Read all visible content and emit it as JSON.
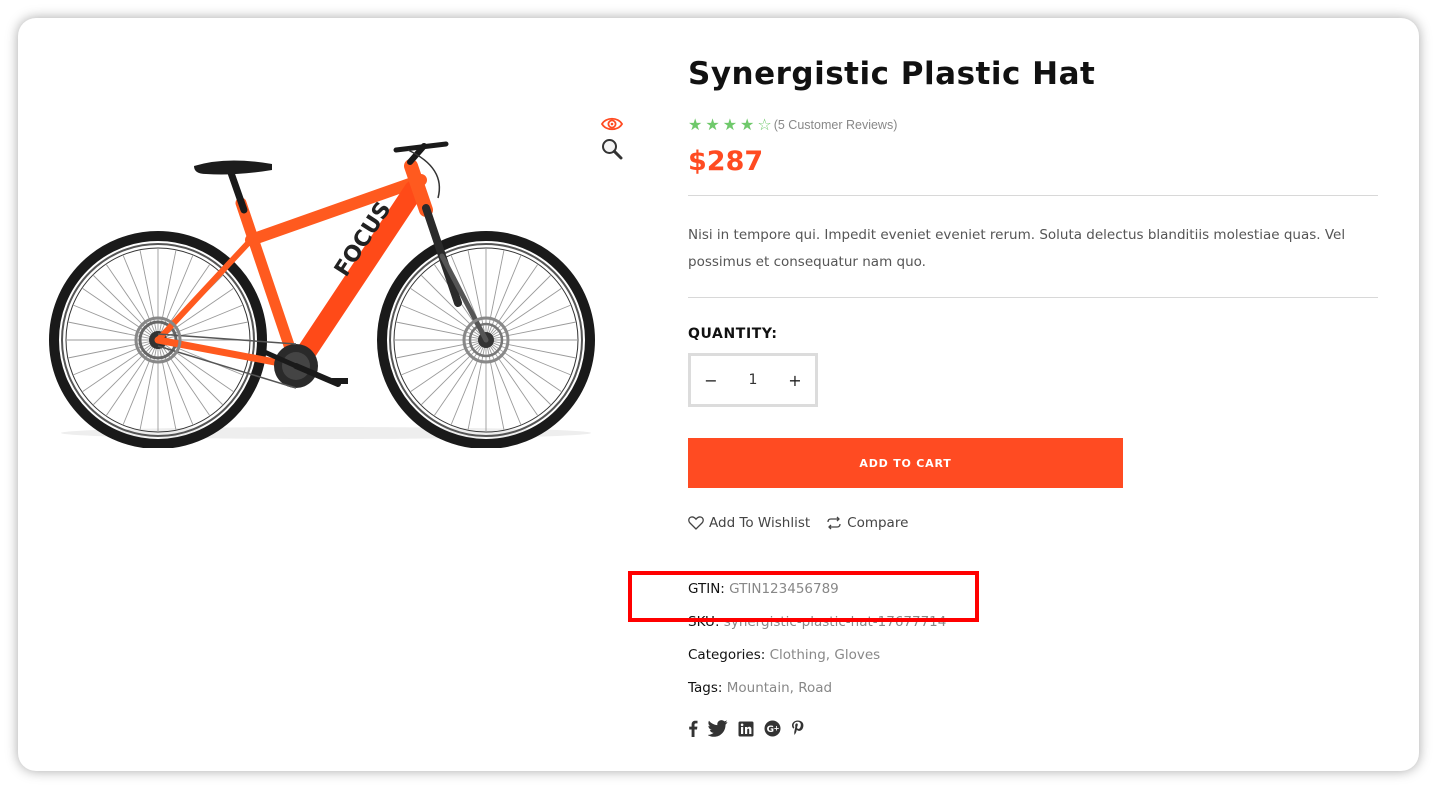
{
  "product": {
    "title": "Synergistic Plastic Hat",
    "rating": 4,
    "rating_max": 5,
    "reviews_text": "(5 Customer Reviews)",
    "price": "$287",
    "description": "Nisi in tempore qui. Impedit eveniet eveniet rerum. Soluta delectus blanditiis molestiae quas. Vel possimus et consequatur nam quo.",
    "image_brand_text": "FOCUS"
  },
  "quantity": {
    "label": "QUANTITY:",
    "value": "1",
    "minus": "−",
    "plus": "+"
  },
  "cart": {
    "add_label": "ADD TO CART"
  },
  "actions": {
    "wishlist_label": "Add To Wishlist",
    "compare_label": "Compare"
  },
  "meta": {
    "gtin_label": "GTIN:",
    "gtin_value": "GTIN123456789",
    "sku_label": "SKU:",
    "sku_value": "synergistic-plastic-hat-17677714",
    "categories_label": "Categories:",
    "categories": [
      "Clothing",
      "Gloves"
    ],
    "tags_label": "Tags:",
    "tags": [
      "Mountain",
      "Road"
    ]
  },
  "social": [
    "facebook-icon",
    "twitter-icon",
    "linkedin-icon",
    "google-plus-icon",
    "pinterest-icon"
  ],
  "colors": {
    "accent": "#ff4b22",
    "stars": "#6fc96b",
    "highlight": "#ff0000"
  }
}
